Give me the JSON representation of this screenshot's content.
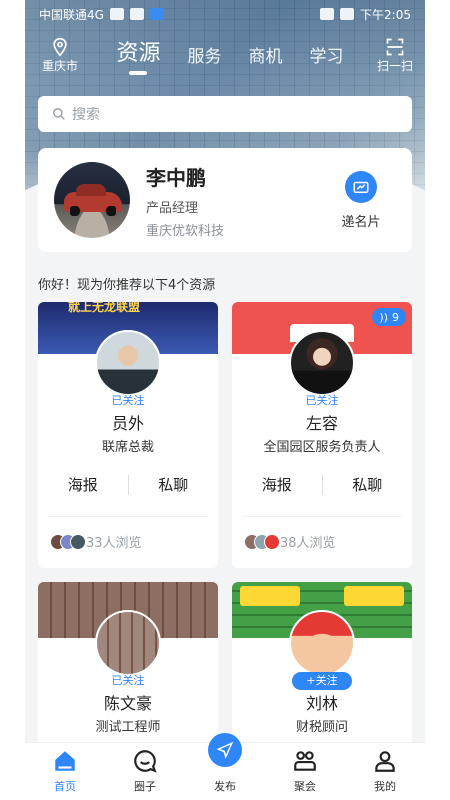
{
  "status_bar": {
    "carrier": "中国联通4G",
    "network": "4G",
    "time": "下午2:05"
  },
  "top_nav": {
    "location": "重庆市",
    "tabs": [
      {
        "label": "资源",
        "active": true
      },
      {
        "label": "服务",
        "active": false
      },
      {
        "label": "商机",
        "active": false
      },
      {
        "label": "学习",
        "active": false
      }
    ],
    "scan_label": "扫一扫"
  },
  "search": {
    "placeholder": "搜索"
  },
  "profile": {
    "name": "李中鹏",
    "role": "产品经理",
    "company": "重庆优软科技",
    "card_button": "递名片"
  },
  "recommend_text": "你好！现为你推荐以下4个资源",
  "resources": [
    {
      "name": "员外",
      "title": "联席总裁",
      "follow": "已关注",
      "actions": [
        "海报",
        "私聊"
      ],
      "views": "33人浏览",
      "banner_text": "就上无龙联盟"
    },
    {
      "name": "左容",
      "title": "全国园区服务负责人",
      "follow": "已关注",
      "actions": [
        "海报",
        "私聊"
      ],
      "views": "38人浏览",
      "badge": "9"
    },
    {
      "name": "陈文豪",
      "title": "测试工程师",
      "follow": "已关注"
    },
    {
      "name": "刘林",
      "title": "财税顾问",
      "follow": "+关注"
    }
  ],
  "tab_bar": [
    {
      "label": "首页",
      "icon": "home-icon",
      "active": true
    },
    {
      "label": "圈子",
      "icon": "chat-bubble-icon",
      "active": false
    },
    {
      "label": "发布",
      "icon": "send-icon",
      "active": false
    },
    {
      "label": "聚会",
      "icon": "group-icon",
      "active": false
    },
    {
      "label": "我的",
      "icon": "user-icon",
      "active": false
    }
  ],
  "colors": {
    "accent": "#2f86f6",
    "card_banner_red": "#ef5350"
  }
}
